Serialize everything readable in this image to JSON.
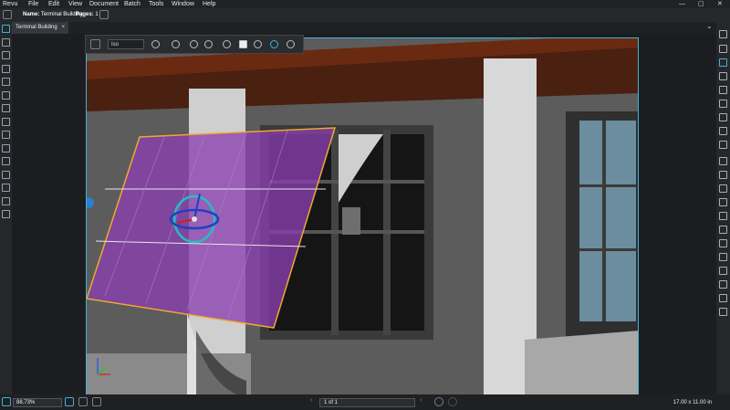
{
  "menu": {
    "items": [
      "Revu",
      "File",
      "Edit",
      "View",
      "Document",
      "Batch",
      "Tools",
      "Window",
      "Help"
    ]
  },
  "window_controls": {
    "minimize": "—",
    "maximize": "▢",
    "close": "✕"
  },
  "doc_info": {
    "name_label": "Name:",
    "name_value": "Terminal Building",
    "pages_label": "Pages:",
    "pages_value": "1"
  },
  "tabs": [
    {
      "label": "Terminal Building",
      "close": "×"
    }
  ],
  "tab_overflow": "⌄",
  "toolbar_3d": {
    "view_select": "Iso"
  },
  "status": {
    "zoom": "88.73%",
    "page_indicator": "1 of 1",
    "page_dims": "17.00 x 11.00 in"
  },
  "colors": {
    "accent": "#3fb3d8",
    "plane_fill": "#8a3fb0",
    "plane_edge": "#f0a830",
    "roof": "#5e2410"
  }
}
